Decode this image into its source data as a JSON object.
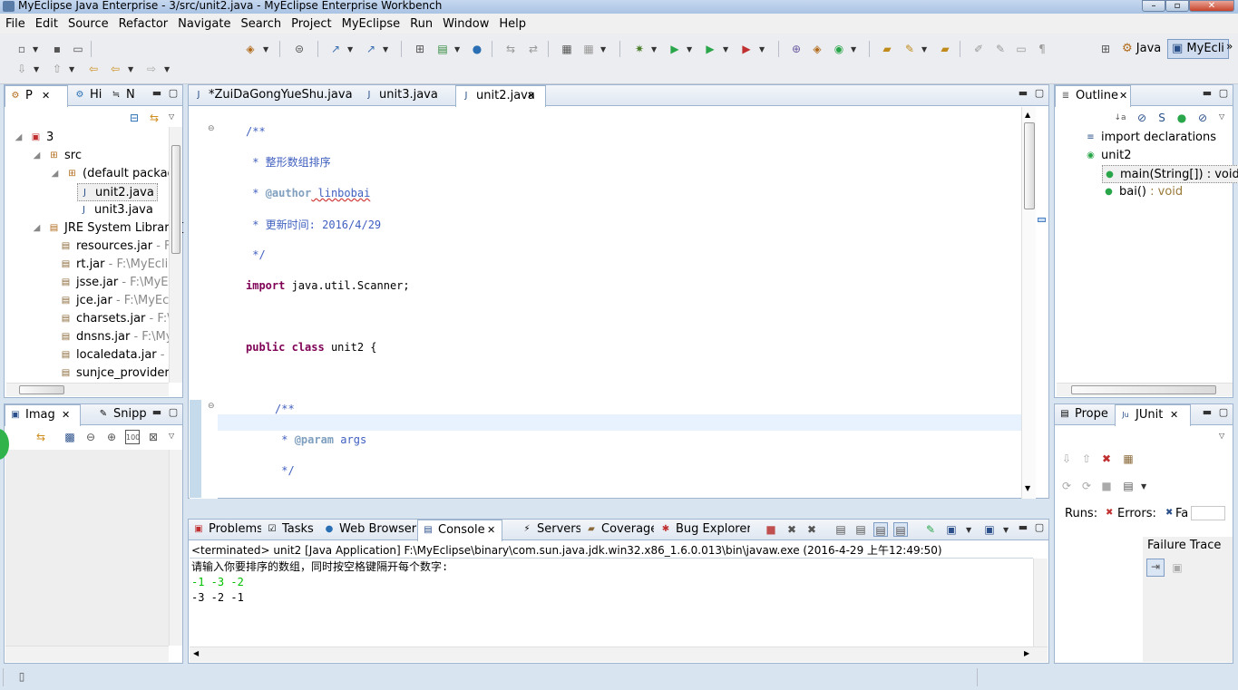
{
  "window": {
    "title": "MyEclipse Java Enterprise - 3/src/unit2.java - MyEclipse Enterprise Workbench"
  },
  "menu": [
    "File",
    "Edit",
    "Source",
    "Refactor",
    "Navigate",
    "Search",
    "Project",
    "MyEclipse",
    "Run",
    "Window",
    "Help"
  ],
  "perspectives": {
    "java": "Java",
    "myeclipse": "MyEcli"
  },
  "explorer": {
    "tabs": [
      "P",
      "Hi",
      "N"
    ],
    "tree": [
      {
        "label": "3",
        "extra": ""
      },
      {
        "label": "src",
        "extra": ""
      },
      {
        "label": "(default package",
        "extra": ""
      },
      {
        "label": "unit2.java",
        "extra": ""
      },
      {
        "label": "unit3.java",
        "extra": ""
      },
      {
        "label": "JRE System Library [",
        "extra": ""
      },
      {
        "label": "resources.jar",
        "extra": " - F:"
      },
      {
        "label": "rt.jar",
        "extra": " - F:\\MyEclip"
      },
      {
        "label": "jsse.jar",
        "extra": " - F:\\MyEc"
      },
      {
        "label": "jce.jar",
        "extra": " - F:\\MyEcl"
      },
      {
        "label": "charsets.jar",
        "extra": " - F:\\"
      },
      {
        "label": "dnsns.jar",
        "extra": " - F:\\My"
      },
      {
        "label": "localedata.jar",
        "extra": " - F"
      },
      {
        "label": "sunjce_provider.j",
        "extra": ""
      }
    ]
  },
  "image_panel": {
    "tabs": [
      "Imag",
      "Snipp"
    ]
  },
  "editor": {
    "tabs": [
      "*ZuiDaGongYueShu.java",
      "unit3.java",
      "unit2.java"
    ],
    "active_tab": "unit2.java",
    "lines": {
      "l1": "/**",
      "l2": " * 整形数组排序",
      "l3a": " * ",
      "l3b": "@author",
      "l3c": " linbobai",
      "l4": " * 更新时间: 2016/4/29",
      "l5": " */",
      "l6a": "import",
      "l6b": " java.util.Scanner;",
      "l7a": "public",
      "l7b": "class",
      "l7c": " unit2 {",
      "l8": "/**",
      "l9a": " * ",
      "l9b": "@param",
      "l9c": " args",
      "l10": " */"
    }
  },
  "outline": {
    "tab": "Outline",
    "items": [
      {
        "label": "import declarations",
        "suffix": ""
      },
      {
        "label": "unit2",
        "suffix": ""
      },
      {
        "label": "main(String[])",
        "suffix": " : void"
      },
      {
        "label": "bai()",
        "suffix": " : void"
      }
    ]
  },
  "bottom": {
    "tabs": [
      "Problems",
      "Tasks",
      "Web Browser",
      "Console",
      "Servers",
      "Coverage",
      "Bug Explorer"
    ],
    "active_tab": "Console",
    "terminated": "<terminated> unit2 [Java Application] F:\\MyEclipse\\binary\\com.sun.java.jdk.win32.x86_1.6.0.013\\bin\\javaw.exe (2016-4-29 上午12:49:50)",
    "prompt": "请输入你要排序的数组，同时按空格键隔开每个数字:",
    "input": "-1 -3 -2",
    "output": "-3 -2 -1"
  },
  "junit": {
    "tabs": [
      "Prope",
      "JUnit"
    ],
    "runs_label": "Runs:",
    "errors_label": "Errors:",
    "failures_label": "Fa",
    "failure_trace": "Failure Trace"
  },
  "colors": {
    "keyword": "#7f0055",
    "comment": "#3f5fbf",
    "javadoc_tag": "#7f9fbf",
    "input": "#00c000",
    "current_line": "#e8f2fe"
  }
}
